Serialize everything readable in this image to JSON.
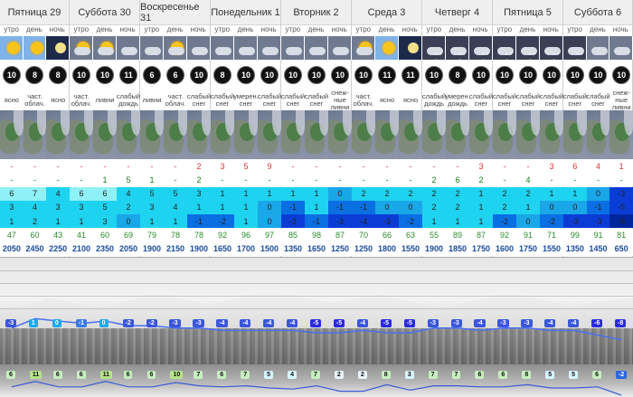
{
  "periods": [
    "утро",
    "день",
    "ночь"
  ],
  "colors": {
    "blue": [
      "#d9f7fb",
      "#8ff0f6",
      "#1ed3f0",
      "#19a7e8",
      "#0a6fe3",
      "#0b3dd6",
      "#00269c"
    ],
    "temp_low": "#b9e9b6",
    "temp_hi": "#74cc6c"
  },
  "days": [
    {
      "name": "Пятница 29",
      "icons": [
        "sun",
        "sun",
        "moon"
      ],
      "wind": [
        "10",
        "8",
        "8"
      ],
      "cond": [
        "ясно",
        "част. облач.",
        "ясно"
      ],
      "precip": [
        "-",
        "-",
        "-"
      ],
      "snow": [
        "-",
        "-",
        "-"
      ],
      "t1": [
        "6",
        "7",
        "4"
      ],
      "t2": [
        "3",
        "4",
        "3"
      ],
      "t3": [
        "1",
        "2",
        "1"
      ],
      "hum": [
        "47",
        "60",
        "43"
      ],
      "alt": [
        "2050",
        "2450",
        "2250"
      ]
    },
    {
      "name": "Суббота 30",
      "icons": [
        "cloudsun",
        "cloudsun",
        "cloud"
      ],
      "wind": [
        "10",
        "10",
        "11"
      ],
      "cond": [
        "част. облач.",
        "ливни",
        "слабый дождь"
      ],
      "precip": [
        "-",
        "-",
        "-"
      ],
      "snow": [
        "-",
        "1",
        "5"
      ],
      "t1": [
        "6",
        "6",
        "4"
      ],
      "t2": [
        "3",
        "5",
        "2"
      ],
      "t3": [
        "1",
        "3",
        "0"
      ],
      "hum": [
        "41",
        "60",
        "69"
      ],
      "alt": [
        "2100",
        "2350",
        "2050"
      ]
    },
    {
      "name": "Воскресенье 31",
      "icons": [
        "cloud",
        "cloudsun",
        "cloud"
      ],
      "wind": [
        "6",
        "6",
        "10"
      ],
      "cond": [
        "ливни",
        "част. облач.",
        "слабый снег"
      ],
      "precip": [
        "-",
        "-",
        "2"
      ],
      "snow": [
        "1",
        "-",
        "2"
      ],
      "t1": [
        "5",
        "5",
        "3"
      ],
      "t2": [
        "3",
        "4",
        "1"
      ],
      "t3": [
        "1",
        "1",
        "-1"
      ],
      "hum": [
        "79",
        "78",
        "78"
      ],
      "alt": [
        "1900",
        "2150",
        "1900"
      ]
    },
    {
      "name": "Понедельник 1",
      "icons": [
        "cloud",
        "cloud",
        "cloud"
      ],
      "wind": [
        "8",
        "10",
        "10"
      ],
      "cond": [
        "слабый снег",
        "умерен. снег",
        "слабый снег"
      ],
      "precip": [
        "3",
        "5",
        "9"
      ],
      "snow": [
        "-",
        "-",
        "-"
      ],
      "t1": [
        "1",
        "1",
        "1"
      ],
      "t2": [
        "1",
        "1",
        "0"
      ],
      "t3": [
        "-2",
        "1",
        "0"
      ],
      "hum": [
        "92",
        "96",
        "97"
      ],
      "alt": [
        "1650",
        "1700",
        "1500"
      ]
    },
    {
      "name": "Вторник 2",
      "icons": [
        "cloud",
        "cloud",
        "cloud"
      ],
      "wind": [
        "10",
        "10",
        "10"
      ],
      "cond": [
        "слабый снег",
        "слабый снег",
        "снеж- ные ливни"
      ],
      "precip": [
        "-",
        "-",
        "-"
      ],
      "snow": [
        "-",
        "-",
        "-"
      ],
      "t1": [
        "1",
        "1",
        "0"
      ],
      "t2": [
        "-1",
        "1",
        "-1"
      ],
      "t3": [
        "-3",
        "-1",
        "-3"
      ],
      "hum": [
        "85",
        "98",
        "87"
      ],
      "alt": [
        "1350",
        "1650",
        "1250"
      ]
    },
    {
      "name": "Среда 3",
      "icons": [
        "cloudsun",
        "sun",
        "moon"
      ],
      "wind": [
        "10",
        "11",
        "11"
      ],
      "cond": [
        "част. облач.",
        "ясно",
        "ясно"
      ],
      "precip": [
        "-",
        "-",
        "-"
      ],
      "snow": [
        "-",
        "-",
        "-"
      ],
      "t1": [
        "2",
        "2",
        "2"
      ],
      "t2": [
        "-1",
        "0",
        "0"
      ],
      "t3": [
        "-4",
        "-3",
        "-2"
      ],
      "hum": [
        "70",
        "66",
        "63"
      ],
      "alt": [
        "1250",
        "1800",
        "1550"
      ]
    },
    {
      "name": "Четверг 4",
      "icons": [
        "light",
        "light",
        "light"
      ],
      "wind": [
        "10",
        "8",
        "10"
      ],
      "cond": [
        "слабый дождь",
        "умерен. дождь",
        "слабый снег"
      ],
      "precip": [
        "-",
        "-",
        "3"
      ],
      "snow": [
        "2",
        "6",
        "2"
      ],
      "t1": [
        "2",
        "2",
        "1"
      ],
      "t2": [
        "2",
        "2",
        "1"
      ],
      "t3": [
        "1",
        "1",
        "1"
      ],
      "hum": [
        "55",
        "89",
        "87"
      ],
      "alt": [
        "1900",
        "1850",
        "1750"
      ]
    },
    {
      "name": "Пятница 5",
      "icons": [
        "light",
        "light",
        "light"
      ],
      "wind": [
        "10",
        "10",
        "10"
      ],
      "cond": [
        "слабый снег",
        "слабый снег",
        "слабый снег"
      ],
      "precip": [
        "-",
        "-",
        "3"
      ],
      "snow": [
        "-",
        "4",
        "-"
      ],
      "t1": [
        "2",
        "2",
        "1"
      ],
      "t2": [
        "2",
        "1",
        "0"
      ],
      "t3": [
        "-2",
        "0",
        "-2"
      ],
      "hum": [
        "92",
        "91",
        "71"
      ],
      "alt": [
        "1600",
        "1750",
        "1550"
      ]
    },
    {
      "name": "Суббота 6",
      "icons": [
        "light",
        "cloud",
        "cloud"
      ],
      "wind": [
        "10",
        "10",
        "10"
      ],
      "cond": [
        "слабый снег",
        "слабый снег",
        "снеж- ные ливни"
      ],
      "precip": [
        "6",
        "4",
        "1"
      ],
      "snow": [
        "-",
        "-",
        "-"
      ],
      "t1": [
        "1",
        "0",
        "-3"
      ],
      "t2": [
        "0",
        "-1",
        "-5"
      ],
      "t3": [
        "-3",
        "-3",
        "-8"
      ],
      "hum": [
        "99",
        "91",
        "81"
      ],
      "alt": [
        "1350",
        "1450",
        "650"
      ]
    }
  ],
  "chart_data": {
    "type": "line",
    "upper_labels": [
      "-3",
      "1",
      "0",
      "-1",
      "0",
      "-2",
      "-2",
      "-3",
      "-3",
      "-4",
      "-4",
      "-4",
      "-4",
      "-5",
      "-5",
      "-4",
      "-5",
      "-5",
      "-3",
      "-3",
      "-4",
      "-3",
      "-3",
      "-4",
      "-4",
      "-6",
      "-8"
    ],
    "lower_labels": [
      "6",
      "11",
      "6",
      "6",
      "11",
      "6",
      "6",
      "10",
      "7",
      "6",
      "7",
      "5",
      "4",
      "7",
      "2",
      "2",
      "8",
      "3",
      "7",
      "7",
      "6",
      "6",
      "8",
      "5",
      "5",
      "6",
      "-2"
    ]
  }
}
